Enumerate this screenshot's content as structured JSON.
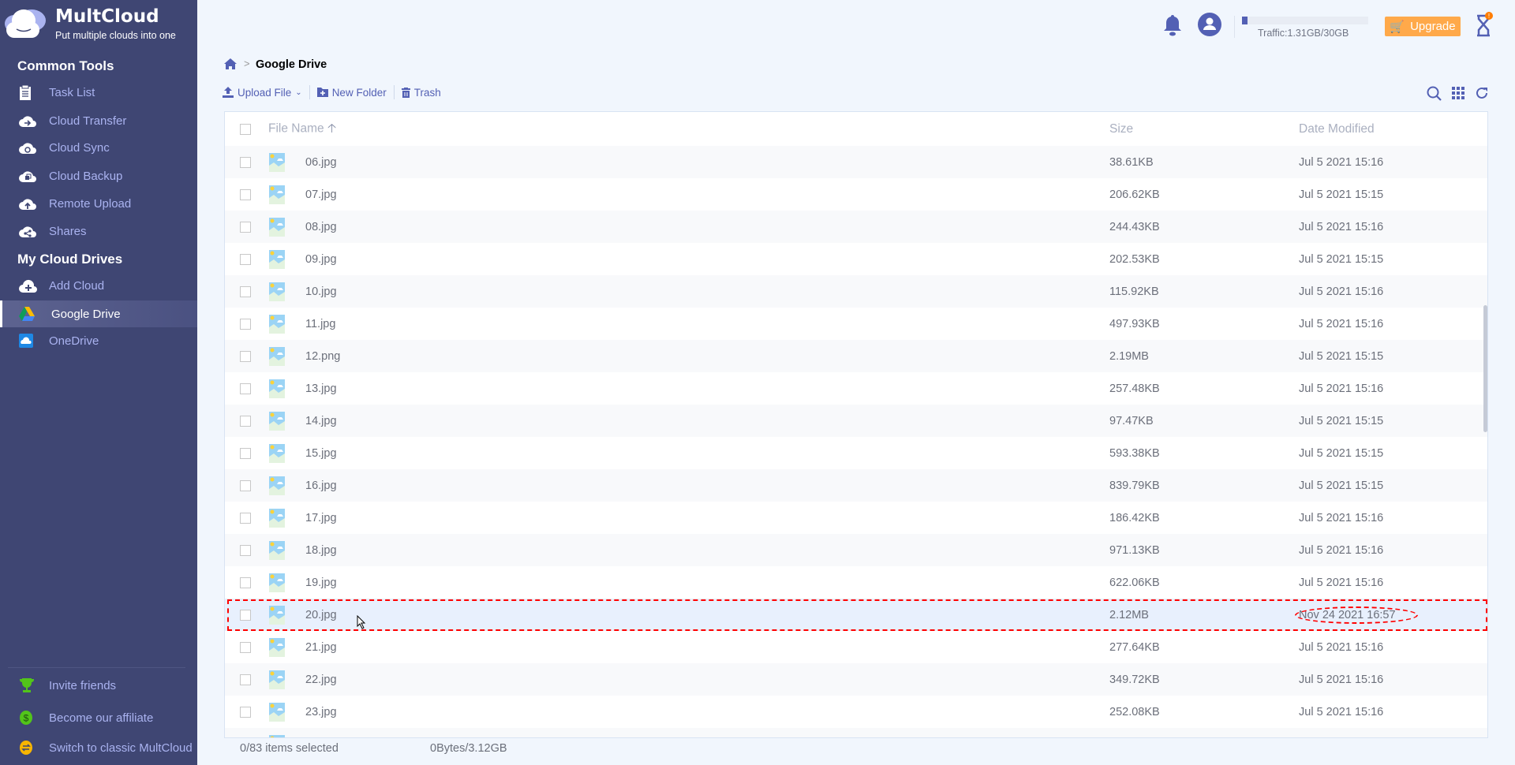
{
  "brand": {
    "name": "MultCloud",
    "tagline": "Put multiple clouds into one"
  },
  "sidebar": {
    "common_tools_heading": "Common Tools",
    "tools": [
      {
        "label": "Task List",
        "icon": "task-list-icon"
      },
      {
        "label": "Cloud Transfer",
        "icon": "cloud-transfer-icon"
      },
      {
        "label": "Cloud Sync",
        "icon": "cloud-sync-icon"
      },
      {
        "label": "Cloud Backup",
        "icon": "cloud-backup-icon"
      },
      {
        "label": "Remote Upload",
        "icon": "remote-upload-icon"
      },
      {
        "label": "Shares",
        "icon": "shares-icon"
      }
    ],
    "drives_heading": "My Cloud Drives",
    "drives": [
      {
        "label": "Add Cloud",
        "icon": "add-cloud-icon"
      },
      {
        "label": "Google Drive",
        "icon": "google-drive-icon",
        "active": true
      },
      {
        "label": "OneDrive",
        "icon": "onedrive-icon"
      }
    ],
    "bottom": [
      {
        "label": "Invite friends",
        "icon": "trophy-icon"
      },
      {
        "label": "Become our affiliate",
        "icon": "dollar-icon"
      },
      {
        "label": "Switch to classic MultCloud",
        "icon": "switch-icon"
      }
    ]
  },
  "header": {
    "traffic": "Traffic:1.31GB/30GB",
    "traffic_used_fraction": 0.044,
    "upgrade": "Upgrade",
    "accent": "#5360b4",
    "upgrade_color": "#ffa94a"
  },
  "breadcrumb": {
    "current": "Google Drive"
  },
  "toolbar": {
    "upload": "Upload File",
    "new_folder": "New Folder",
    "trash": "Trash"
  },
  "table": {
    "columns": {
      "name": "File Name",
      "size": "Size",
      "date": "Date Modified"
    },
    "rows": [
      {
        "name": "06.jpg",
        "size": "38.61KB",
        "date": "Jul 5 2021 15:16"
      },
      {
        "name": "07.jpg",
        "size": "206.62KB",
        "date": "Jul 5 2021 15:15"
      },
      {
        "name": "08.jpg",
        "size": "244.43KB",
        "date": "Jul 5 2021 15:16"
      },
      {
        "name": "09.jpg",
        "size": "202.53KB",
        "date": "Jul 5 2021 15:15"
      },
      {
        "name": "10.jpg",
        "size": "115.92KB",
        "date": "Jul 5 2021 15:16"
      },
      {
        "name": "11.jpg",
        "size": "497.93KB",
        "date": "Jul 5 2021 15:16"
      },
      {
        "name": "12.png",
        "size": "2.19MB",
        "date": "Jul 5 2021 15:15"
      },
      {
        "name": "13.jpg",
        "size": "257.48KB",
        "date": "Jul 5 2021 15:16"
      },
      {
        "name": "14.jpg",
        "size": "97.47KB",
        "date": "Jul 5 2021 15:15"
      },
      {
        "name": "15.jpg",
        "size": "593.38KB",
        "date": "Jul 5 2021 15:15"
      },
      {
        "name": "16.jpg",
        "size": "839.79KB",
        "date": "Jul 5 2021 15:15"
      },
      {
        "name": "17.jpg",
        "size": "186.42KB",
        "date": "Jul 5 2021 15:16"
      },
      {
        "name": "18.jpg",
        "size": "971.13KB",
        "date": "Jul 5 2021 15:16"
      },
      {
        "name": "19.jpg",
        "size": "622.06KB",
        "date": "Jul 5 2021 15:16"
      },
      {
        "name": "20.jpg",
        "size": "2.12MB",
        "date": "Nov 24 2021 16:57",
        "highlighted": true
      },
      {
        "name": "21.jpg",
        "size": "277.64KB",
        "date": "Jul 5 2021 15:16"
      },
      {
        "name": "22.jpg",
        "size": "349.72KB",
        "date": "Jul 5 2021 15:16"
      },
      {
        "name": "23.jpg",
        "size": "252.08KB",
        "date": "Jul 5 2021 15:16"
      },
      {
        "name": "",
        "size": "",
        "date": ""
      }
    ]
  },
  "status": {
    "selected": "0/83 items selected",
    "bytes": "0Bytes/3.12GB"
  }
}
